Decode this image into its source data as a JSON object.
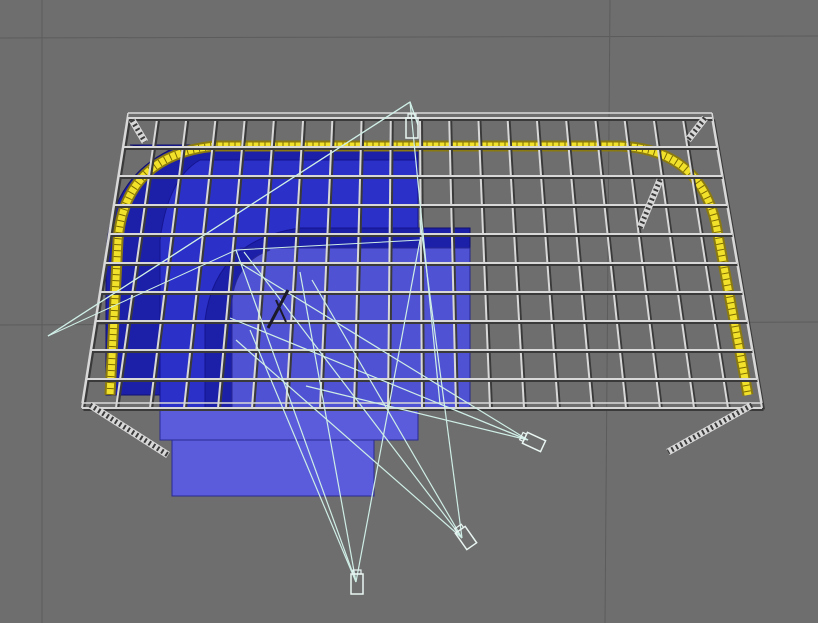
{
  "viewport": {
    "background_color": "#6e6e6e",
    "floor_grid_color": "#5c5c5c"
  },
  "scene": {
    "truss_color": "#d8d8d8",
    "truss_shadow_color": "#3a3a3a",
    "track_color": "#f2e12a",
    "track_edge_color": "#8a7a10",
    "stage_dark_color": "#1c1fa8",
    "stage_mid_color": "#2b30c8",
    "stage_light_color": "#5a5cdc",
    "camera_line_color": "#cfeee6",
    "camera_body_color": "#e9f5f2",
    "cameras": [
      {
        "name": "camera-top"
      },
      {
        "name": "camera-right"
      },
      {
        "name": "camera-bottom-right"
      },
      {
        "name": "camera-bottom"
      }
    ]
  }
}
